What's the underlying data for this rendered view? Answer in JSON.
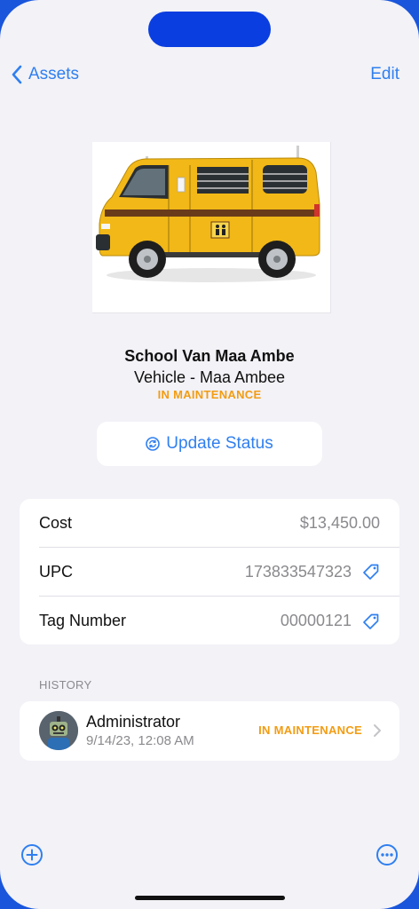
{
  "nav": {
    "back_label": "Assets",
    "edit_label": "Edit"
  },
  "asset": {
    "name": "School Van Maa Ambe",
    "subtitle": "Vehicle - Maa Ambee",
    "status": "IN MAINTENANCE",
    "image": "yellow-school-van"
  },
  "actions": {
    "update_status_label": "Update Status"
  },
  "details": {
    "cost": {
      "label": "Cost",
      "value": "$13,450.00"
    },
    "upc": {
      "label": "UPC",
      "value": "173833547323"
    },
    "tag_number": {
      "label": "Tag Number",
      "value": "00000121"
    }
  },
  "history": {
    "header": "HISTORY",
    "entries": [
      {
        "user": "Administrator",
        "date": "9/14/23, 12:08 AM",
        "status": "IN MAINTENANCE"
      }
    ]
  },
  "colors": {
    "accent": "#2f7ff0",
    "status": "#f39c12",
    "background": "#f2f2f7",
    "frame": "#1a56db"
  },
  "toolbar": {
    "left_icon": "plus-circle-icon",
    "right_icon": "ellipsis-circle-icon"
  }
}
